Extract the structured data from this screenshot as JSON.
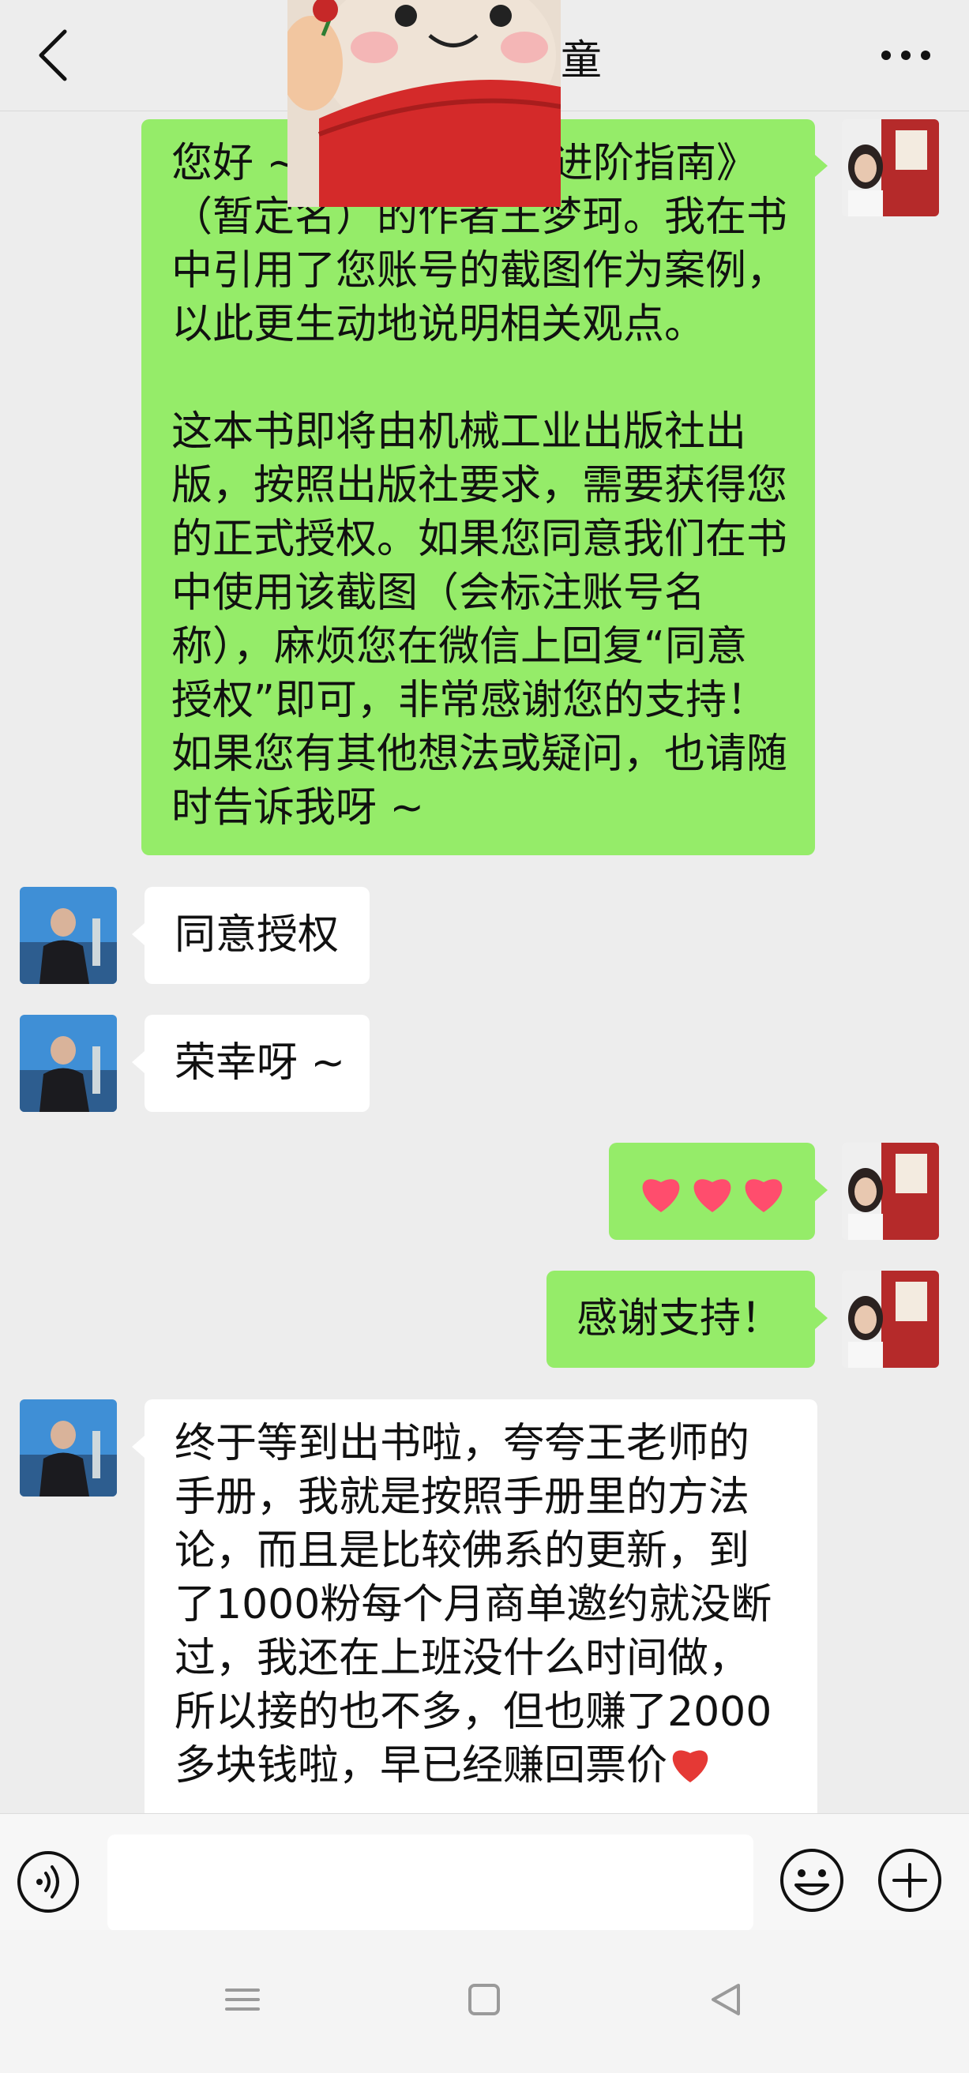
{
  "header": {
    "title_visible": "童",
    "back_icon": "chevron-left-icon",
    "more_icon": "more-dots-icon"
  },
  "messages": [
    {
      "side": "right",
      "color": "#95ec69",
      "lines": [
        "您好 ~",
        "进阶指南》",
        "（暂定名）的作者王梦珂。我在书",
        "中引用了您账号的截图作为案例，",
        "以此更生动地说明相关观点。",
        "",
        "这本书即将由机械工业出版社出",
        "版，按照出版社要求，需要获得您",
        "的正式授权。如果您同意我们在书",
        "中使用该截图（会标注账号名",
        "称），麻烦您在微信上回复“同意",
        "授权”即可，非常感谢您的支持！",
        "如果您有其他想法或疑问，也请随",
        "时告诉我呀 ~"
      ]
    },
    {
      "side": "left",
      "color": "#ffffff",
      "text": "同意授权"
    },
    {
      "side": "left",
      "color": "#ffffff",
      "text": "荣幸呀 ~"
    },
    {
      "side": "right",
      "color": "#95ec69",
      "hearts": 3
    },
    {
      "side": "right",
      "color": "#95ec69",
      "text": "感谢支持！"
    },
    {
      "side": "left",
      "color": "#ffffff",
      "lines": [
        "终于等到出书啦，夸夸王老师的",
        "手册，我就是按照手册里的方法",
        "论，而且是比较佛系的更新，到",
        "了1000粉每个月商单邀约就没断",
        "过，我还在上班没什么时间做，",
        "所以接的也不多，但也赚了2000",
        "多块钱啦，早已经赚回票价"
      ]
    }
  ],
  "input_bar": {
    "voice_icon": "voice-icon",
    "emoji_icon": "emoji-icon",
    "plus_icon": "plus-icon",
    "placeholder": ""
  },
  "nav_bar": {
    "menu_icon": "menu-icon",
    "home_icon": "home-icon",
    "back_icon": "back-triangle-icon"
  },
  "colors": {
    "background": "#ededed",
    "self_bubble": "#95ec69",
    "other_bubble": "#ffffff",
    "heart": "#ff4d6d"
  }
}
